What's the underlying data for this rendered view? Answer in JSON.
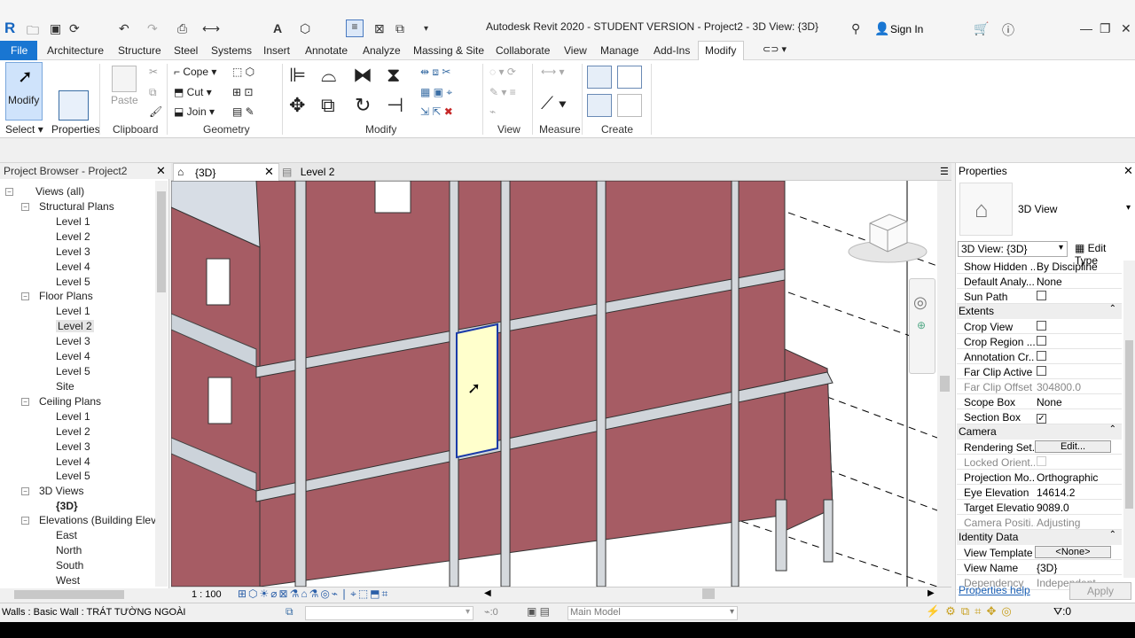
{
  "window": {
    "title": "Autodesk Revit 2020 - STUDENT VERSION - Project2 - 3D View: {3D}",
    "sign_in": "Sign In",
    "logo": "R"
  },
  "ribbon_tabs": [
    "File",
    "Architecture",
    "Structure",
    "Steel",
    "Systems",
    "Insert",
    "Annotate",
    "Analyze",
    "Massing & Site",
    "Collaborate",
    "View",
    "Manage",
    "Add-Ins",
    "Modify"
  ],
  "ribbon": {
    "modify": "Modify",
    "properties": "Properties",
    "paste": "Paste",
    "cope": "Cope",
    "cut": "Cut",
    "join": "Join",
    "panels": {
      "select": "Select",
      "properties": "Properties",
      "clipboard": "Clipboard",
      "geometry": "Geometry",
      "modify": "Modify",
      "view": "View",
      "measure": "Measure",
      "create": "Create"
    }
  },
  "project_browser": {
    "title": "Project Browser - Project2",
    "items": [
      "Views (all)",
      "Structural Plans",
      "Level 1",
      "Level 2",
      "Level 3",
      "Level 4",
      "Level 5",
      "Floor Plans",
      "Level 1",
      "Level 2",
      "Level 3",
      "Level 4",
      "Level 5",
      "Site",
      "Ceiling Plans",
      "Level 1",
      "Level 2",
      "Level 3",
      "Level 4",
      "Level 5",
      "3D Views",
      "{3D}",
      "Elevations (Building Elevat",
      "East",
      "North",
      "South",
      "West"
    ]
  },
  "view_tabs": {
    "active": "{3D}",
    "other": "Level 2"
  },
  "view_control": {
    "scale": "1 : 100"
  },
  "properties": {
    "title": "Properties",
    "type": "3D View",
    "selector": "3D View: {3D}",
    "edit_type": "Edit Type",
    "rows": [
      {
        "k": "Show Hidden ...",
        "v": "By Discipline"
      },
      {
        "k": "Default Analy...",
        "v": "None"
      },
      {
        "k": "Sun Path",
        "v": "",
        "cb": "off"
      },
      {
        "section": "Extents"
      },
      {
        "k": "Crop View",
        "v": "",
        "cb": "off"
      },
      {
        "k": "Crop Region ...",
        "v": "",
        "cb": "off"
      },
      {
        "k": "Annotation Cr...",
        "v": "",
        "cb": "off"
      },
      {
        "k": "Far Clip Active",
        "v": "",
        "cb": "off"
      },
      {
        "k": "Far Clip Offset",
        "v": "304800.0",
        "grey": true
      },
      {
        "k": "Scope Box",
        "v": "None"
      },
      {
        "k": "Section Box",
        "v": "",
        "cb": "on"
      },
      {
        "section": "Camera"
      },
      {
        "k": "Rendering Set...",
        "v": "Edit...",
        "btn": true
      },
      {
        "k": "Locked Orient...",
        "v": "",
        "cb": "grey",
        "grey": true
      },
      {
        "k": "Projection Mo...",
        "v": "Orthographic"
      },
      {
        "k": "Eye Elevation",
        "v": "14614.2"
      },
      {
        "k": "Target Elevation",
        "v": "9089.0"
      },
      {
        "k": "Camera Positi...",
        "v": "Adjusting",
        "grey": true
      },
      {
        "section": "Identity Data"
      },
      {
        "k": "View Template",
        "v": "<None>",
        "btn": true
      },
      {
        "k": "View Name",
        "v": "{3D}"
      },
      {
        "k": "Dependency",
        "v": "Independent",
        "grey": true
      }
    ],
    "help": "Properties help",
    "apply": "Apply"
  },
  "status": {
    "text": "Walls : Basic Wall : TRÁT TƯỜNG NGOÀI",
    "model": "Main Model",
    "sel_count": ":0",
    "filter_count": ":0"
  },
  "colors": {
    "wall": "#a65c64",
    "accent": "#1976d2",
    "highlight": "#ffffcc"
  }
}
